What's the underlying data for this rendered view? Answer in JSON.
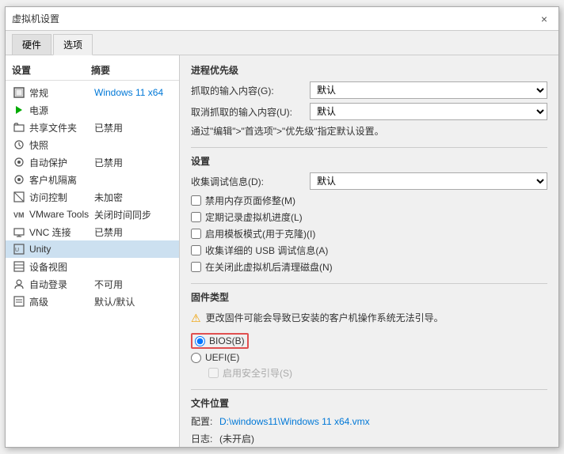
{
  "dialog": {
    "title": "虚拟机设置",
    "close_button": "×"
  },
  "tabs": [
    {
      "id": "hardware",
      "label": "硬件"
    },
    {
      "id": "options",
      "label": "选项",
      "active": true
    }
  ],
  "left_panel": {
    "header": {
      "col1": "设置",
      "col2": "摘要"
    },
    "items": [
      {
        "id": "general",
        "icon": "□",
        "name": "常规",
        "desc": "Windows 11 x64",
        "desc_colored": true
      },
      {
        "id": "power",
        "icon": "▶",
        "name": "电源",
        "desc": ""
      },
      {
        "id": "shared_folder",
        "icon": "≡",
        "name": "共享文件夹",
        "desc": "已禁用",
        "desc_colored": false
      },
      {
        "id": "snapshot",
        "icon": "↺",
        "name": "快照",
        "desc": ""
      },
      {
        "id": "autosave",
        "icon": "⊙",
        "name": "自动保护",
        "desc": "已禁用",
        "desc_colored": false
      },
      {
        "id": "guest_isolation",
        "icon": "⊙",
        "name": "客户机隔离",
        "desc": ""
      },
      {
        "id": "access_control",
        "icon": "□",
        "name": "访问控制",
        "desc": "未加密",
        "desc_colored": false
      },
      {
        "id": "vmware_tools",
        "icon": "vm",
        "name": "VMware Tools",
        "desc": "关闭时间同步",
        "desc_colored": false
      },
      {
        "id": "vnc",
        "icon": "≡",
        "name": "VNC 连接",
        "desc": "已禁用",
        "desc_colored": false
      },
      {
        "id": "unity",
        "icon": "□",
        "name": "Unity",
        "desc": "",
        "selected": true
      },
      {
        "id": "device_view",
        "icon": "≡",
        "name": "设备视图",
        "desc": ""
      },
      {
        "id": "auto_login",
        "icon": "⊙",
        "name": "自动登录",
        "desc": "不可用",
        "desc_colored": false
      },
      {
        "id": "advanced",
        "icon": "□",
        "name": "高级",
        "desc": "默认/默认",
        "desc_colored": false
      }
    ]
  },
  "right_panel": {
    "priority_section": {
      "title": "进程优先级",
      "grab_input_label": "抓取的输入内容(G):",
      "grab_input_value": "默认",
      "ungrab_input_label": "取消抓取的输入内容(U):",
      "ungrab_input_value": "默认",
      "hint": "通过\"编辑\">\"首选项\">\"优先级\"指定默认设置。"
    },
    "settings_section": {
      "title": "设置",
      "collect_debug_label": "收集调试信息(D):",
      "collect_debug_value": "默认",
      "checkboxes": [
        {
          "id": "disable_mem",
          "label": "禁用内存页面修整(M)",
          "checked": false
        },
        {
          "id": "periodic_snapshot",
          "label": "定期记录虚拟机进度(L)",
          "checked": false
        },
        {
          "id": "template_mode",
          "label": "启用模板模式(用于克隆)(I)",
          "checked": false
        },
        {
          "id": "collect_usb",
          "label": "收集详细的 USB 调试信息(A)",
          "checked": false
        },
        {
          "id": "clean_disk",
          "label": "在关闭此虚拟机后清理磁盘(N)",
          "checked": false
        }
      ]
    },
    "firmware_section": {
      "title": "固件类型",
      "warning": "更改固件可能会导致已安装的客户机操作系统无法引导。",
      "options": [
        {
          "id": "bios",
          "label": "BIOS(B)",
          "selected": true,
          "highlighted": true
        },
        {
          "id": "uefi",
          "label": "UEFI(E)",
          "selected": false
        }
      ],
      "uefi_secure_boot_label": "启用安全引导(S)",
      "uefi_secure_boot_checked": false,
      "uefi_secure_boot_enabled": false
    },
    "file_section": {
      "title": "文件位置",
      "config_label": "配置:",
      "config_path": "D:\\windows11\\Windows 11 x64.vmx",
      "log_label": "日志:",
      "log_value": "(未开启)"
    }
  }
}
